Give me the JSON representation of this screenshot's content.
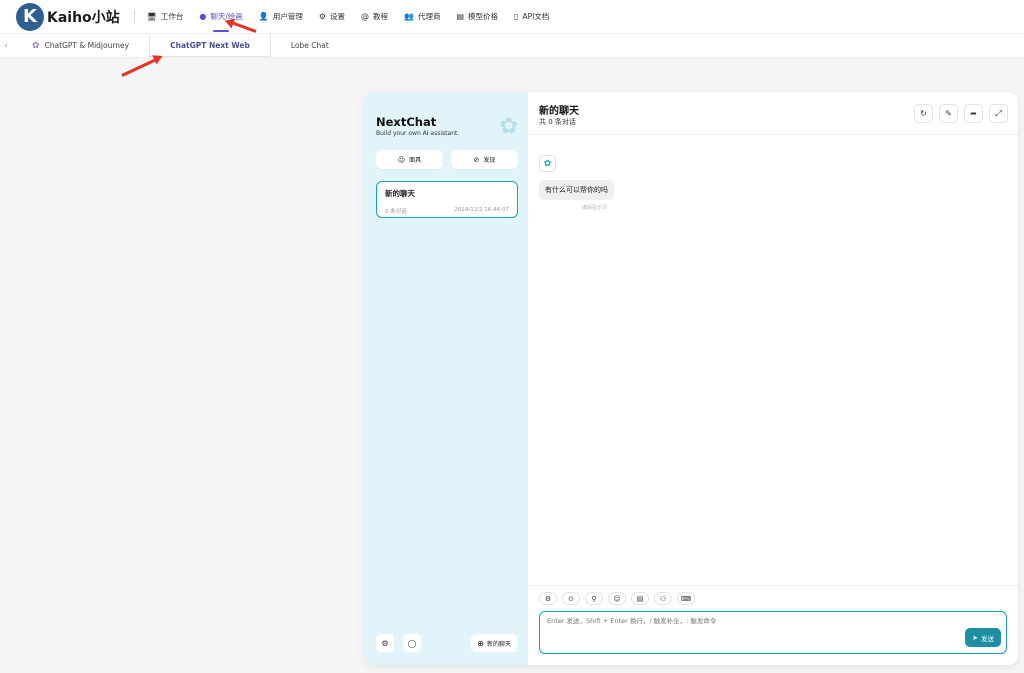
{
  "brand": {
    "name": "Kaiho小站",
    "logo_letter": "K"
  },
  "nav": {
    "items": [
      {
        "label": "工作台",
        "icon": "monitor-icon"
      },
      {
        "label": "聊天/绘画",
        "icon": "chat-bubble-icon",
        "active": true
      },
      {
        "label": "用户管理",
        "icon": "user-icon"
      },
      {
        "label": "设置",
        "icon": "gear-icon"
      },
      {
        "label": "教程",
        "icon": "at-icon"
      },
      {
        "label": "代理商",
        "icon": "group-icon"
      },
      {
        "label": "模型价格",
        "icon": "tag-icon"
      },
      {
        "label": "API文档",
        "icon": "book-icon"
      }
    ]
  },
  "subtabs": {
    "items": [
      {
        "label": "ChatGPT & Midjourney",
        "icon": "openai-icon"
      },
      {
        "label": "ChatGPT Next Web",
        "active": true
      },
      {
        "label": "Lobe Chat"
      }
    ]
  },
  "sidebar": {
    "title": "NextChat",
    "subtitle": "Build your own AI assistant.",
    "mask_button": "面具",
    "discover_button": "发现",
    "chats": [
      {
        "title": "新的聊天",
        "count": "0 条对话",
        "time": "2024/12/2 16:44:07"
      }
    ],
    "new_chat_button": "新的聊天"
  },
  "main": {
    "title": "新的聊天",
    "subtitle": "共 0 条对话",
    "messages": [
      {
        "role": "assistant",
        "text": "有什么可以帮你的吗"
      }
    ],
    "hint": "编辑提示词",
    "input_placeholder": "Enter 发送，Shift + Enter 换行，/ 触发补全，: 触发命令",
    "send_label": "发送"
  },
  "colors": {
    "accent": "#1aa2b4",
    "nav_active": "#5a4fcf",
    "sidebar_bg": "#e1f4fa",
    "annotation_arrow": "#e53222"
  }
}
